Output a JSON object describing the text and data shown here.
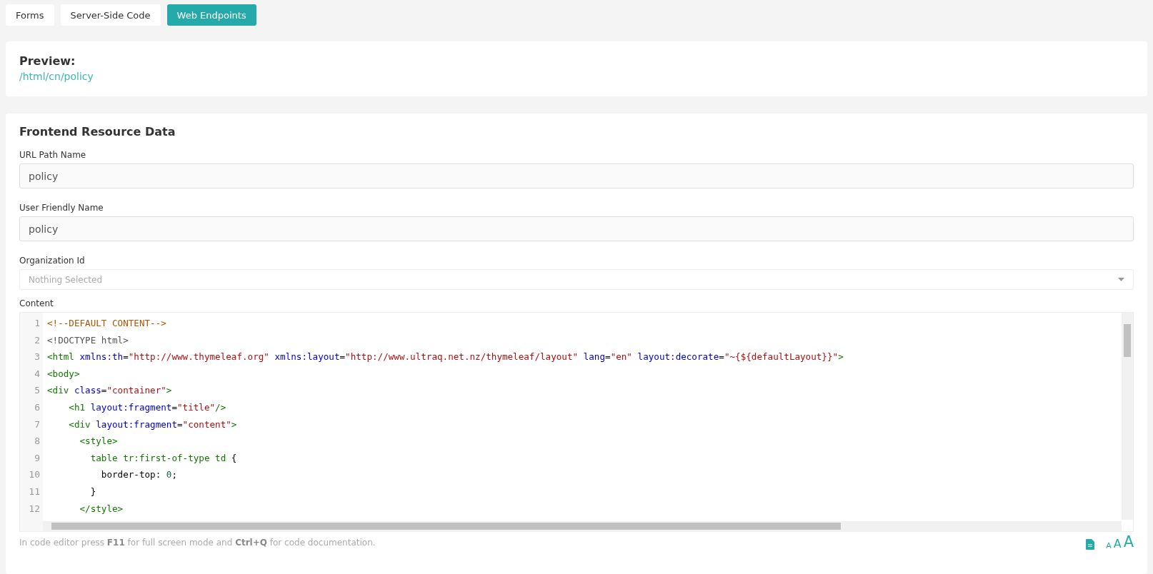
{
  "tabs": [
    {
      "label": "Forms",
      "selected": false
    },
    {
      "label": "Server-Side Code",
      "selected": false
    },
    {
      "label": "Web Endpoints",
      "selected": true
    }
  ],
  "preview": {
    "title": "Preview:",
    "link": "/html/cn/policy"
  },
  "form": {
    "title": "Frontend Resource Data",
    "fields": [
      {
        "kind": "text",
        "label": "URL Path Name",
        "value": "policy"
      },
      {
        "kind": "text",
        "label": "User Friendly Name",
        "value": "policy"
      },
      {
        "kind": "select",
        "label": "Organization Id",
        "placeholder": "Nothing Selected"
      }
    ],
    "content": {
      "label": "Content",
      "lines": [
        {
          "number": "1",
          "tokens": [
            {
              "kind": "comment",
              "text": "<!--DEFAULT CONTENT-->"
            }
          ]
        },
        {
          "number": "2",
          "tokens": [
            {
              "kind": "meta",
              "text": "<!DOCTYPE html>"
            }
          ]
        },
        {
          "number": "3",
          "tokens": [
            {
              "kind": "tag",
              "text": "<html"
            },
            {
              "kind": "attr",
              "text": " xmlns:th"
            },
            {
              "kind": "plain",
              "text": "="
            },
            {
              "kind": "string",
              "text": "\"http://www.thymeleaf.org\""
            },
            {
              "kind": "attr",
              "text": " xmlns:layout"
            },
            {
              "kind": "plain",
              "text": "="
            },
            {
              "kind": "string",
              "text": "\"http://www.ultraq.net.nz/thymeleaf/layout\""
            },
            {
              "kind": "attr",
              "text": " lang"
            },
            {
              "kind": "plain",
              "text": "="
            },
            {
              "kind": "string",
              "text": "\"en\""
            },
            {
              "kind": "attr",
              "text": " layout:decorate"
            },
            {
              "kind": "plain",
              "text": "="
            },
            {
              "kind": "string",
              "text": "\"~{${defaultLayout}}\""
            },
            {
              "kind": "tag",
              "text": ">"
            }
          ]
        },
        {
          "number": "4",
          "tokens": [
            {
              "kind": "tag",
              "text": "<body>"
            }
          ]
        },
        {
          "number": "5",
          "tokens": [
            {
              "kind": "tag",
              "text": "<div"
            },
            {
              "kind": "attr",
              "text": " class"
            },
            {
              "kind": "plain",
              "text": "="
            },
            {
              "kind": "string",
              "text": "\"container\""
            },
            {
              "kind": "tag",
              "text": ">"
            }
          ]
        },
        {
          "number": "6",
          "tokens": [
            {
              "kind": "tag",
              "text": "    <h1"
            },
            {
              "kind": "attr",
              "text": " layout:fragment"
            },
            {
              "kind": "plain",
              "text": "="
            },
            {
              "kind": "string",
              "text": "\"title\""
            },
            {
              "kind": "tag",
              "text": "/>"
            }
          ]
        },
        {
          "number": "7",
          "tokens": [
            {
              "kind": "tag",
              "text": "    <div"
            },
            {
              "kind": "attr",
              "text": " layout:fragment"
            },
            {
              "kind": "plain",
              "text": "="
            },
            {
              "kind": "string",
              "text": "\"content\""
            },
            {
              "kind": "tag",
              "text": ">"
            }
          ]
        },
        {
          "number": "8",
          "tokens": [
            {
              "kind": "tag",
              "text": "      <style>"
            }
          ]
        },
        {
          "number": "9",
          "tokens": [
            {
              "kind": "tag",
              "text": "        table tr"
            },
            {
              "kind": "property",
              "text": ":first-of-type"
            },
            {
              "kind": "tag",
              "text": " td"
            },
            {
              "kind": "plain",
              "text": " {"
            }
          ]
        },
        {
          "number": "10",
          "tokens": [
            {
              "kind": "plain",
              "text": "          border-top: "
            },
            {
              "kind": "number",
              "text": "0"
            },
            {
              "kind": "plain",
              "text": ";"
            }
          ]
        },
        {
          "number": "11",
          "tokens": [
            {
              "kind": "plain",
              "text": "        }"
            }
          ]
        },
        {
          "number": "12",
          "tokens": [
            {
              "kind": "tag",
              "text": "      </style>"
            }
          ]
        }
      ],
      "hint": "In code editor press **F11** for full screen mode and **Ctrl+Q** for code documentation.",
      "font_sizes": [
        "A",
        "A",
        "A"
      ]
    }
  }
}
